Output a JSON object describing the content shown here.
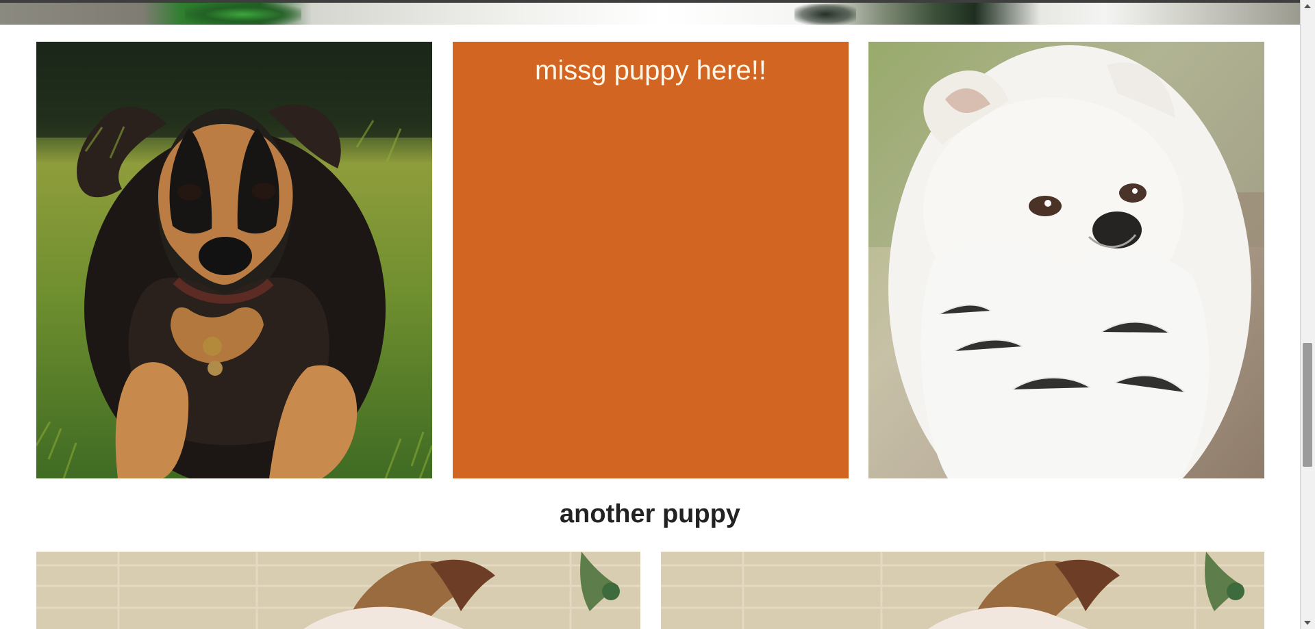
{
  "page": {
    "missing_tile_text": "missg puppy here!!",
    "section_heading": "another puppy"
  },
  "images": {
    "top_strip": "partially visible banner image",
    "puppy_left": "black-and-tan puppy photo",
    "puppy_right": "white fluffy puppy photo",
    "bottom_left": "partially visible puppy photo",
    "bottom_right": "partially visible puppy photo"
  },
  "scrollbar": {
    "thumb_position": 0.54,
    "thumb_size": 0.2
  },
  "colors": {
    "missing_tile_background": "#d36522",
    "missing_tile_text": "#fff8ea",
    "heading": "#222222"
  }
}
